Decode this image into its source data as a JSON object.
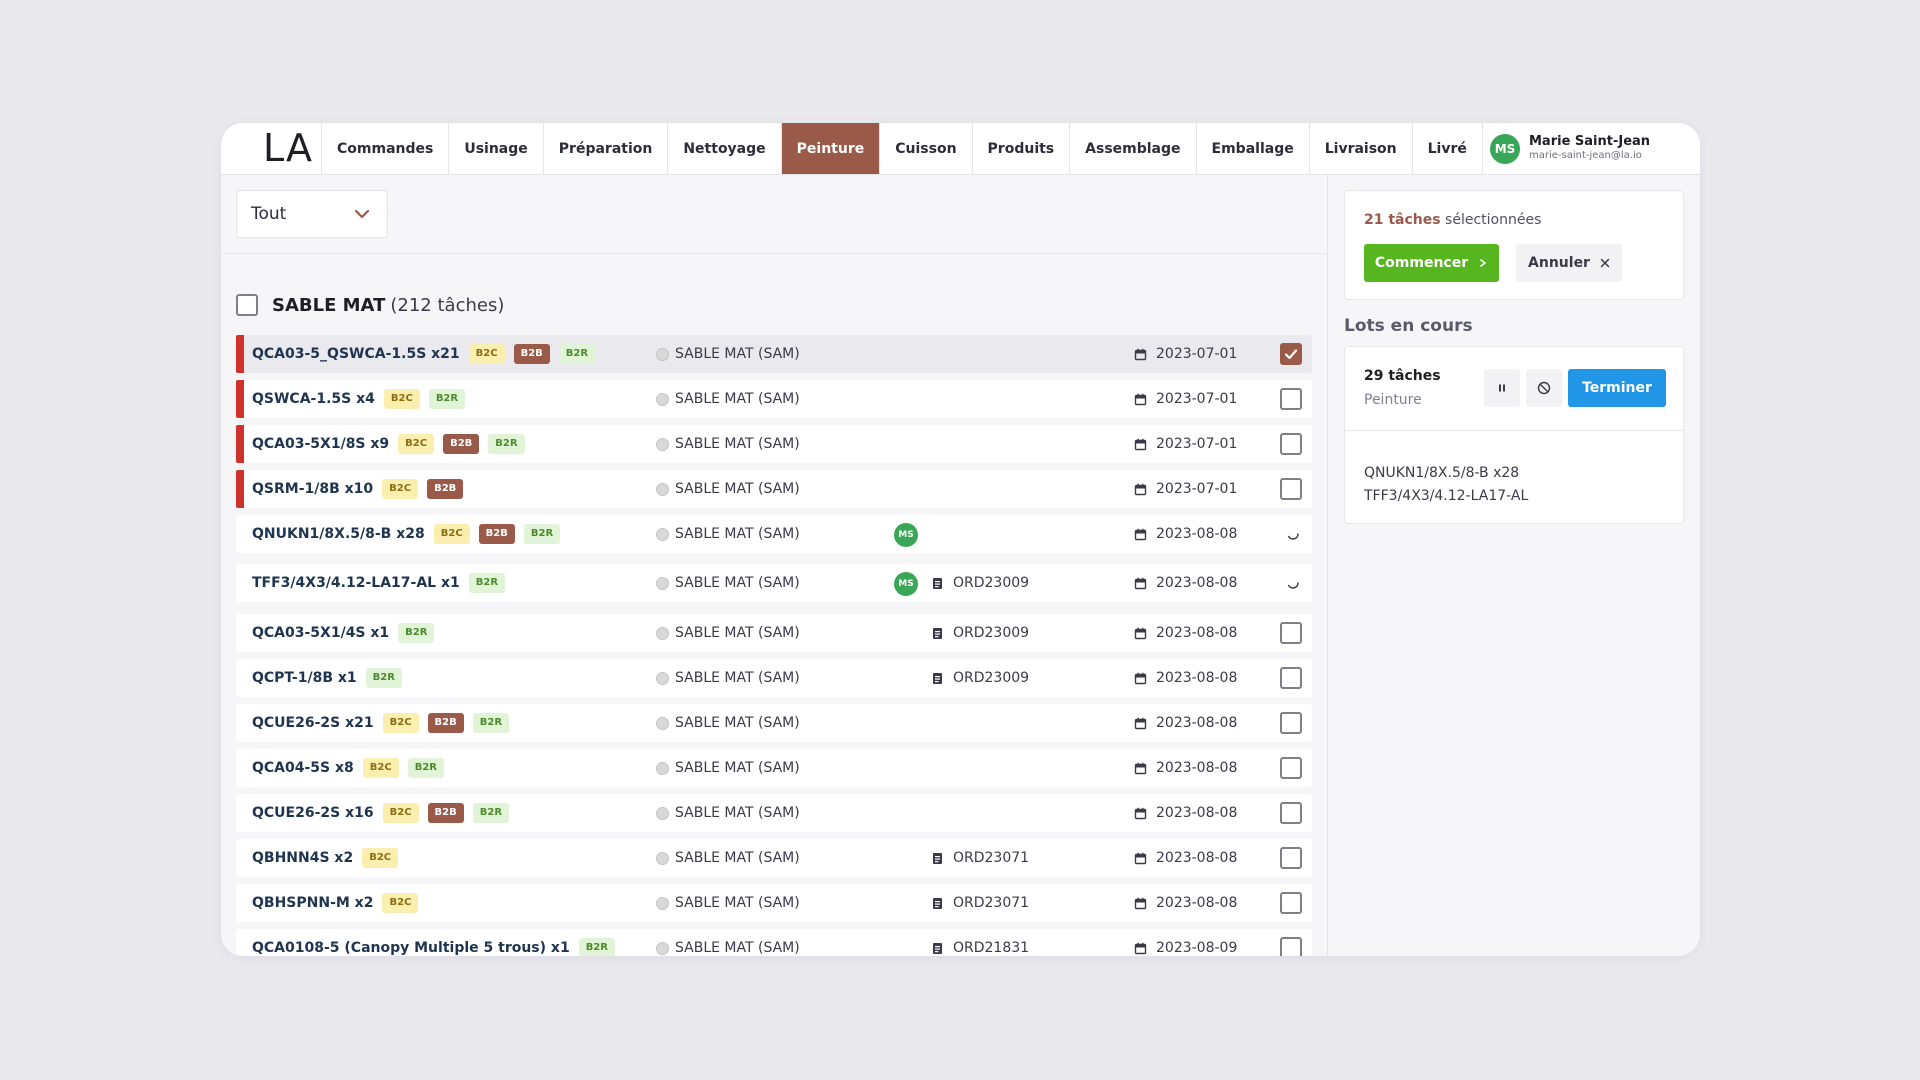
{
  "header": {
    "logo": "LA",
    "tabs": [
      {
        "label": "Commandes"
      },
      {
        "label": "Usinage"
      },
      {
        "label": "Préparation"
      },
      {
        "label": "Nettoyage"
      },
      {
        "label": "Peinture",
        "active": true
      },
      {
        "label": "Cuisson"
      },
      {
        "label": "Produits"
      },
      {
        "label": "Assemblage"
      },
      {
        "label": "Emballage"
      },
      {
        "label": "Livraison"
      },
      {
        "label": "Livré"
      }
    ],
    "user": {
      "initials": "MS",
      "name": "Marie Saint-Jean",
      "email": "marie-saint-jean@la.io"
    }
  },
  "filter": {
    "selected": "Tout"
  },
  "group": {
    "title": "SABLE MAT",
    "count": "(212 tâches)"
  },
  "rows": [
    {
      "name": "QCA03-5_QSWCA-1.5S x21",
      "badges": [
        "B2C",
        "B2B",
        "B2R"
      ],
      "material": "SABLE MAT (SAM)",
      "assignee": "",
      "order": "",
      "date": "2023-07-01",
      "urgent": true,
      "status": "checked",
      "selected": true
    },
    {
      "name": "QSWCA-1.5S x4",
      "badges": [
        "B2C",
        "B2R"
      ],
      "material": "SABLE MAT (SAM)",
      "assignee": "",
      "order": "",
      "date": "2023-07-01",
      "urgent": true,
      "status": "unchecked"
    },
    {
      "name": "QCA03-5X1/8S x9",
      "badges": [
        "B2C",
        "B2B",
        "B2R"
      ],
      "material": "SABLE MAT (SAM)",
      "assignee": "",
      "order": "",
      "date": "2023-07-01",
      "urgent": true,
      "status": "unchecked"
    },
    {
      "name": "QSRM-1/8B x10",
      "badges": [
        "B2C",
        "B2B"
      ],
      "material": "SABLE MAT (SAM)",
      "assignee": "",
      "order": "",
      "date": "2023-07-01",
      "urgent": true,
      "status": "unchecked"
    },
    {
      "name": "QNUKN1/8X.5/8-B x28",
      "badges": [
        "B2C",
        "B2B",
        "B2R"
      ],
      "material": "SABLE MAT (SAM)",
      "assignee": "MS",
      "order": "",
      "date": "2023-08-08",
      "urgent": false,
      "status": "loading"
    },
    {
      "name": "TFF3/4X3/4.12-LA17-AL x1",
      "badges": [
        "B2R"
      ],
      "material": "SABLE MAT (SAM)",
      "assignee": "MS",
      "order": "ORD23009",
      "date": "2023-08-08",
      "urgent": false,
      "status": "loading"
    },
    {
      "name": "QCA03-5X1/4S x1",
      "badges": [
        "B2R"
      ],
      "material": "SABLE MAT (SAM)",
      "assignee": "",
      "order": "ORD23009",
      "date": "2023-08-08",
      "urgent": false,
      "status": "unchecked"
    },
    {
      "name": "QCPT-1/8B x1",
      "badges": [
        "B2R"
      ],
      "material": "SABLE MAT (SAM)",
      "assignee": "",
      "order": "ORD23009",
      "date": "2023-08-08",
      "urgent": false,
      "status": "unchecked"
    },
    {
      "name": "QCUE26-2S x21",
      "badges": [
        "B2C",
        "B2B",
        "B2R"
      ],
      "material": "SABLE MAT (SAM)",
      "assignee": "",
      "order": "",
      "date": "2023-08-08",
      "urgent": false,
      "status": "unchecked"
    },
    {
      "name": "QCA04-5S x8",
      "badges": [
        "B2C",
        "B2R"
      ],
      "material": "SABLE MAT (SAM)",
      "assignee": "",
      "order": "",
      "date": "2023-08-08",
      "urgent": false,
      "status": "unchecked"
    },
    {
      "name": "QCUE26-2S x16",
      "badges": [
        "B2C",
        "B2B",
        "B2R"
      ],
      "material": "SABLE MAT (SAM)",
      "assignee": "",
      "order": "",
      "date": "2023-08-08",
      "urgent": false,
      "status": "unchecked"
    },
    {
      "name": "QBHNN4S x2",
      "badges": [
        "B2C"
      ],
      "material": "SABLE MAT (SAM)",
      "assignee": "",
      "order": "ORD23071",
      "date": "2023-08-08",
      "urgent": false,
      "status": "unchecked"
    },
    {
      "name": "QBHSPNN-M x2",
      "badges": [
        "B2C"
      ],
      "material": "SABLE MAT (SAM)",
      "assignee": "",
      "order": "ORD23071",
      "date": "2023-08-08",
      "urgent": false,
      "status": "unchecked"
    },
    {
      "name": "QCA0108-5 (Canopy Multiple 5 trous) x1",
      "badges": [
        "B2R"
      ],
      "material": "SABLE MAT (SAM)",
      "assignee": "",
      "order": "ORD21831",
      "date": "2023-08-09",
      "urgent": false,
      "status": "unchecked"
    }
  ],
  "selection": {
    "count": "21 tâches",
    "suffix": " sélectionnées",
    "start_label": "Commencer",
    "cancel_label": "Annuler"
  },
  "lots": {
    "title": "Lots en cours",
    "count": "29 tâches",
    "stage": "Peinture",
    "finish_label": "Terminer",
    "items": [
      "QNUKN1/8X.5/8-B x28",
      "TFF3/4X3/4.12-LA17-AL"
    ]
  },
  "colors": {
    "accent": "#9a5a49",
    "urgent": "#d0312d",
    "success": "#57b520",
    "primary": "#2196e6",
    "avatar": "#3aa657"
  }
}
